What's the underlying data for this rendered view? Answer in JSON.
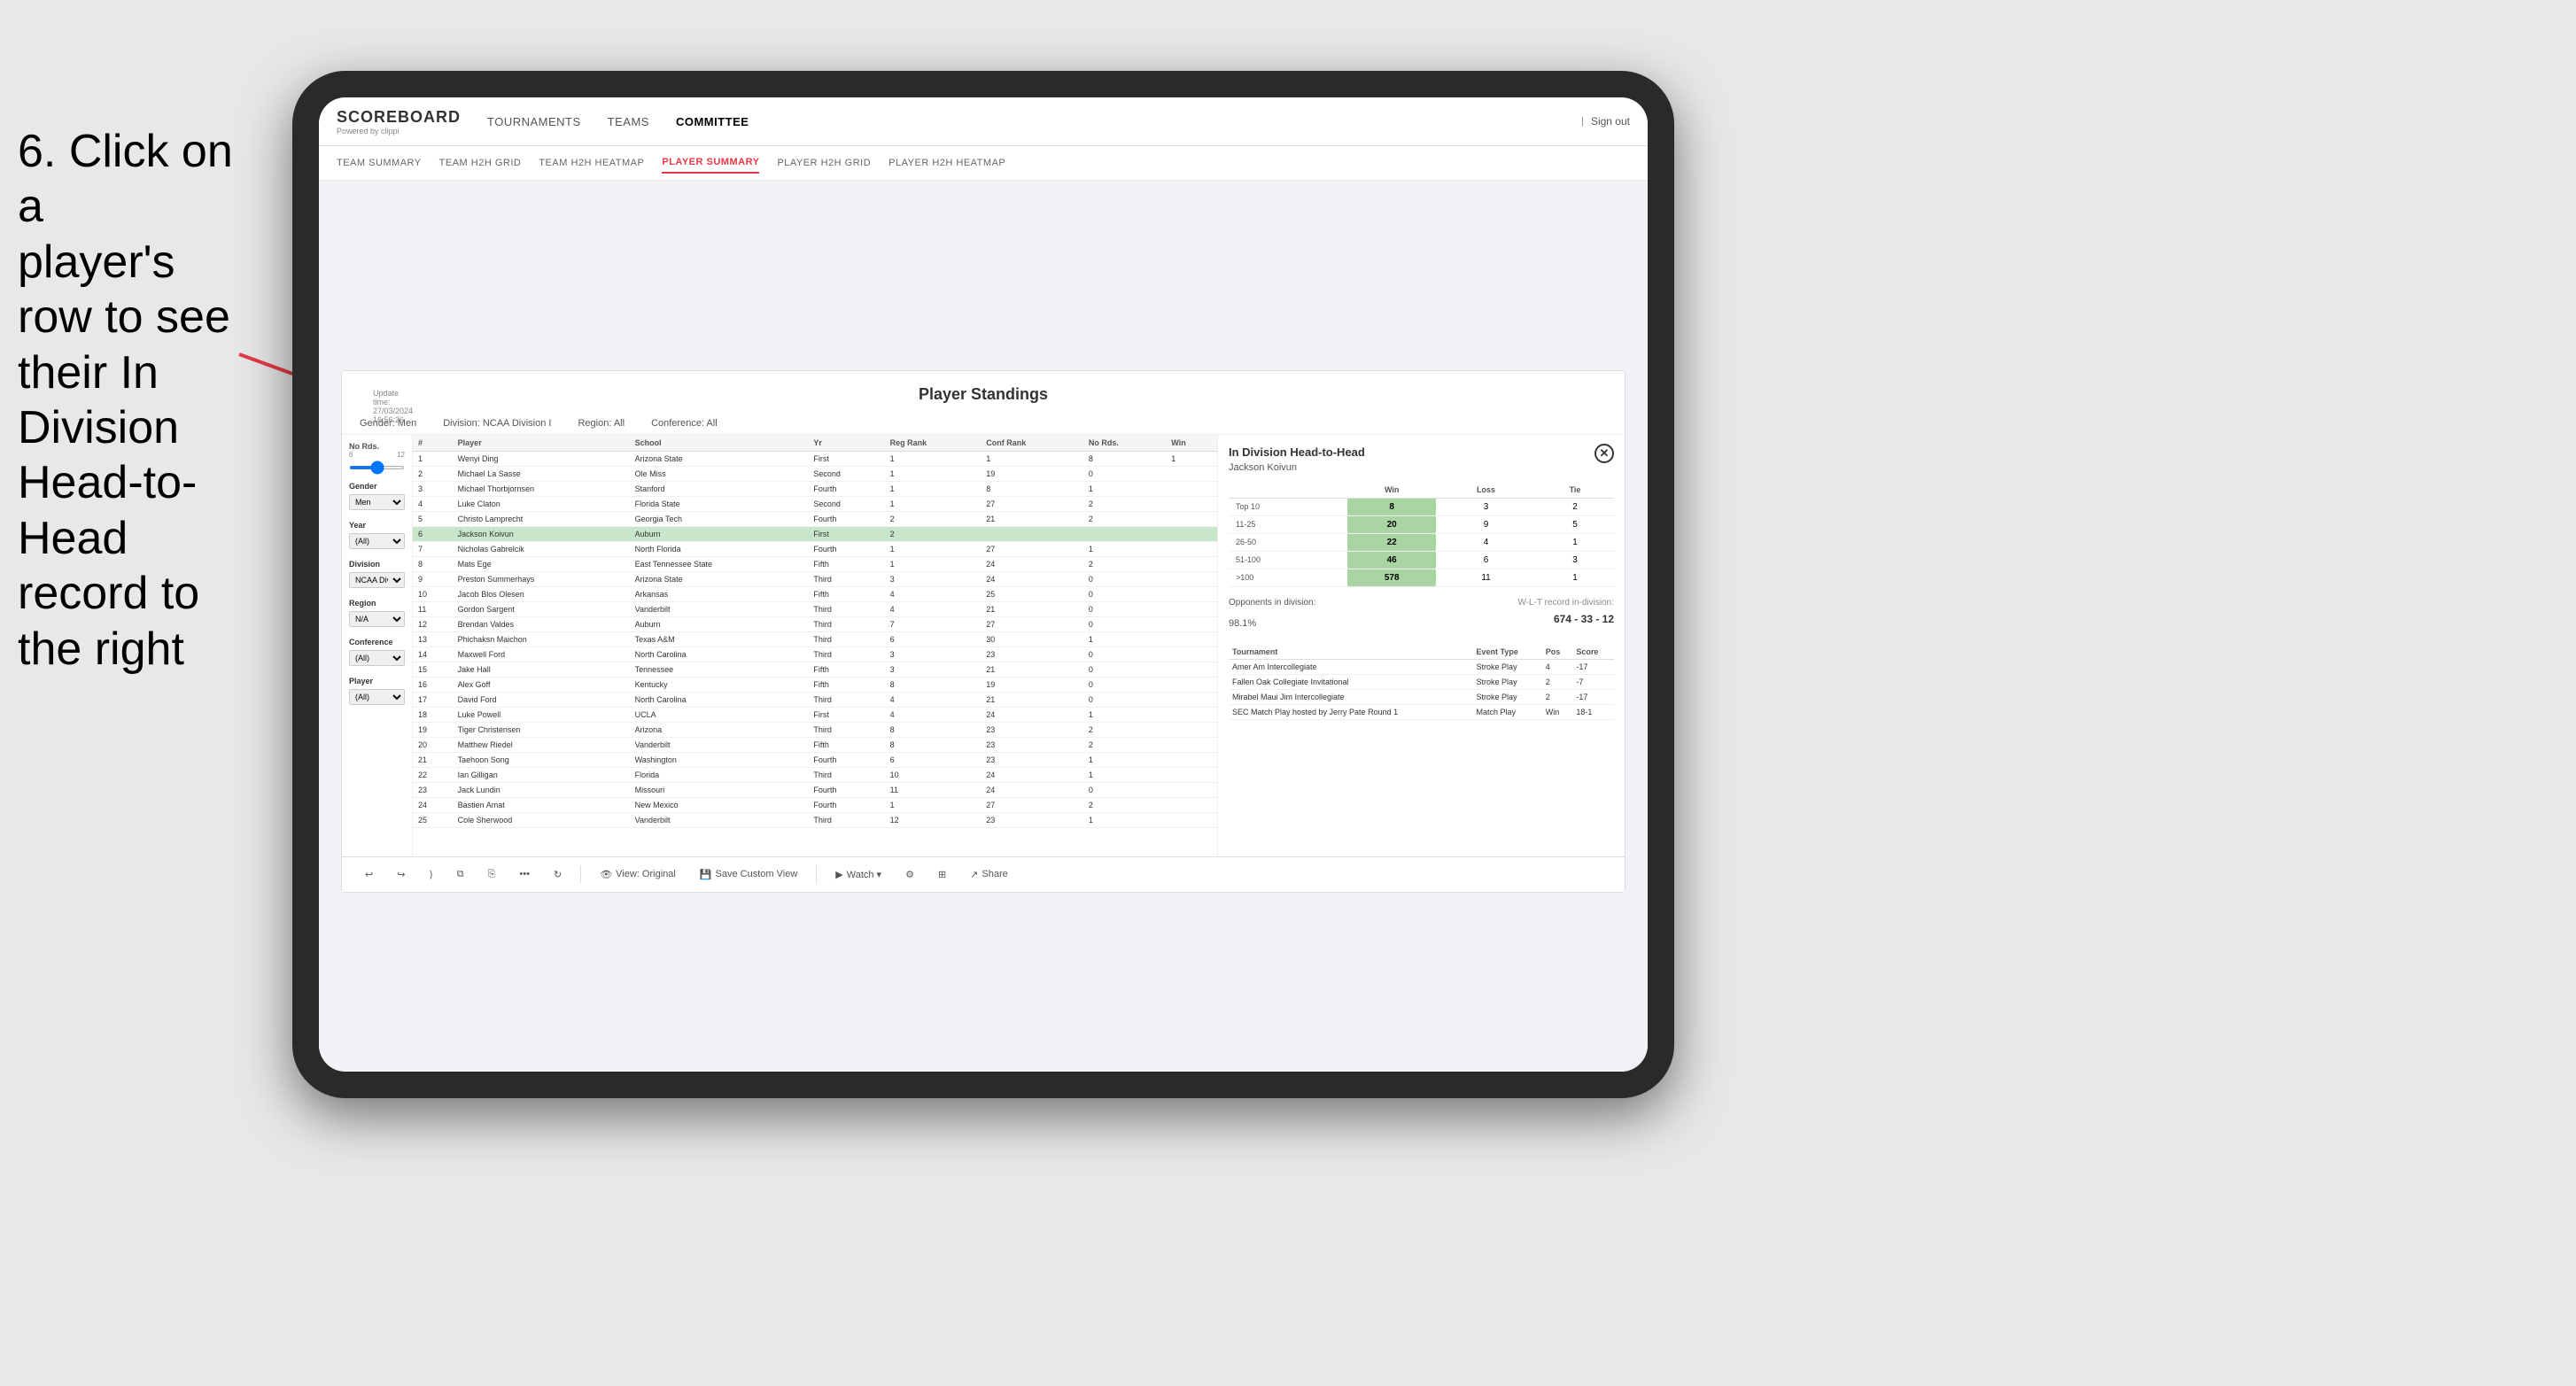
{
  "instruction": {
    "line1": "6. Click on a",
    "line2": "player's row to see",
    "line3": "their In Division",
    "line4": "Head-to-Head",
    "line5": "record to the right"
  },
  "nav": {
    "logo": "SCOREBOARD",
    "logo_sub": "Powered by clippi",
    "items": [
      "TOURNAMENTS",
      "TEAMS",
      "COMMITTEE"
    ],
    "sign_out": "Sign out"
  },
  "sub_nav": {
    "items": [
      "TEAM SUMMARY",
      "TEAM H2H GRID",
      "TEAM H2H HEATMAP",
      "PLAYER SUMMARY",
      "PLAYER H2H GRID",
      "PLAYER H2H HEATMAP"
    ]
  },
  "panel": {
    "title": "Player Standings",
    "update_time": "Update time:",
    "update_datetime": "27/03/2024 16:56:26",
    "filters": {
      "gender": "Gender: Men",
      "division": "Division: NCAA Division I",
      "region": "Region: All",
      "conference": "Conference: All"
    }
  },
  "sidebar": {
    "no_rds_label": "No Rds.",
    "no_rds_values": [
      "6",
      "12"
    ],
    "gender_label": "Gender",
    "gender_value": "Men",
    "year_label": "Year",
    "year_value": "(All)",
    "division_label": "Division",
    "division_value": "NCAA Division I",
    "region_label": "Region",
    "region_value": "N/A",
    "conference_label": "Conference",
    "conference_value": "(All)",
    "player_label": "Player",
    "player_value": "(All)"
  },
  "table": {
    "headers": [
      "#",
      "Player",
      "School",
      "Yr",
      "Reg Rank",
      "Conf Rank",
      "No Rds.",
      "Win"
    ],
    "rows": [
      {
        "num": 1,
        "player": "Wenyi Ding",
        "school": "Arizona State",
        "yr": "First",
        "reg": 1,
        "conf": 1,
        "rds": 8,
        "win": 1
      },
      {
        "num": 2,
        "player": "Michael La Sasse",
        "school": "Ole Miss",
        "yr": "Second",
        "reg": 1,
        "conf": 19,
        "rds": 0
      },
      {
        "num": 3,
        "player": "Michael Thorbjornsen",
        "school": "Stanford",
        "yr": "Fourth",
        "reg": 1,
        "conf": 8,
        "rds": 1
      },
      {
        "num": 4,
        "player": "Luke Claton",
        "school": "Florida State",
        "yr": "Second",
        "reg": 1,
        "conf": 27,
        "rds": 2
      },
      {
        "num": 5,
        "player": "Christo Lamprecht",
        "school": "Georgia Tech",
        "yr": "Fourth",
        "reg": 2,
        "conf": 21,
        "rds": 2
      },
      {
        "num": 6,
        "player": "Jackson Koivun",
        "school": "Auburn",
        "yr": "First",
        "reg": 2,
        "conf": "",
        "rds": "",
        "win": "",
        "highlighted": true
      },
      {
        "num": 7,
        "player": "Nicholas Gabrelcik",
        "school": "North Florida",
        "yr": "Fourth",
        "reg": 1,
        "conf": 27,
        "rds": 1
      },
      {
        "num": 8,
        "player": "Mats Ege",
        "school": "East Tennessee State",
        "yr": "Fifth",
        "reg": 1,
        "conf": 24,
        "rds": 2
      },
      {
        "num": 9,
        "player": "Preston Summerhays",
        "school": "Arizona State",
        "yr": "Third",
        "reg": 3,
        "conf": 24,
        "rds": 0
      },
      {
        "num": 10,
        "player": "Jacob Blos Olesen",
        "school": "Arkansas",
        "yr": "Fifth",
        "reg": 4,
        "conf": 25,
        "rds": 0
      },
      {
        "num": 11,
        "player": "Gordon Sargent",
        "school": "Vanderbilt",
        "yr": "Third",
        "reg": 4,
        "conf": 21,
        "rds": 0
      },
      {
        "num": 12,
        "player": "Brendan Valdes",
        "school": "Auburn",
        "yr": "Third",
        "reg": 7,
        "conf": 27,
        "rds": 0
      },
      {
        "num": 13,
        "player": "Phichaksn Maichon",
        "school": "Texas A&M",
        "yr": "Third",
        "reg": 6,
        "conf": 30,
        "rds": 1
      },
      {
        "num": 14,
        "player": "Maxwell Ford",
        "school": "North Carolina",
        "yr": "Third",
        "reg": 3,
        "conf": 23,
        "rds": 0
      },
      {
        "num": 15,
        "player": "Jake Hall",
        "school": "Tennessee",
        "yr": "Fifth",
        "reg": 3,
        "conf": 21,
        "rds": 0
      },
      {
        "num": 16,
        "player": "Alex Goff",
        "school": "Kentucky",
        "yr": "Fifth",
        "reg": 8,
        "conf": 19,
        "rds": 0
      },
      {
        "num": 17,
        "player": "David Ford",
        "school": "North Carolina",
        "yr": "Third",
        "reg": 4,
        "conf": 21,
        "rds": 0
      },
      {
        "num": 18,
        "player": "Luke Powell",
        "school": "UCLA",
        "yr": "First",
        "reg": 4,
        "conf": 24,
        "rds": 1
      },
      {
        "num": 19,
        "player": "Tiger Christensen",
        "school": "Arizona",
        "yr": "Third",
        "reg": 8,
        "conf": 23,
        "rds": 2
      },
      {
        "num": 20,
        "player": "Matthew Riedel",
        "school": "Vanderbilt",
        "yr": "Fifth",
        "reg": 8,
        "conf": 23,
        "rds": 2
      },
      {
        "num": 21,
        "player": "Taehoon Song",
        "school": "Washington",
        "yr": "Fourth",
        "reg": 6,
        "conf": 23,
        "rds": 1
      },
      {
        "num": 22,
        "player": "Ian Gilligan",
        "school": "Florida",
        "yr": "Third",
        "reg": 10,
        "conf": 24,
        "rds": 1
      },
      {
        "num": 23,
        "player": "Jack Lundin",
        "school": "Missouri",
        "yr": "Fourth",
        "reg": 11,
        "conf": 24,
        "rds": 0
      },
      {
        "num": 24,
        "player": "Bastien Amat",
        "school": "New Mexico",
        "yr": "Fourth",
        "reg": 1,
        "conf": 27,
        "rds": 2
      },
      {
        "num": 25,
        "player": "Cole Sherwood",
        "school": "Vanderbilt",
        "yr": "Third",
        "reg": 12,
        "conf": 23,
        "rds": 1
      }
    ]
  },
  "h2h": {
    "title": "In Division Head-to-Head",
    "player_name": "Jackson Koivun",
    "table": {
      "headers": [
        "",
        "Win",
        "Loss",
        "Tie"
      ],
      "rows": [
        {
          "label": "Top 10",
          "win": 8,
          "loss": 3,
          "tie": 2
        },
        {
          "label": "11-25",
          "win": 20,
          "loss": 9,
          "tie": 5
        },
        {
          "label": "26-50",
          "win": 22,
          "loss": 4,
          "tie": 1
        },
        {
          "label": "51-100",
          "win": 46,
          "loss": 6,
          "tie": 3
        },
        {
          "label": ">100",
          "win": 578,
          "loss": 11,
          "tie": 1
        }
      ]
    },
    "opponents_label": "Opponents in division:",
    "opponents_pct": "98.1%",
    "wl_label": "W-L-T record in-division:",
    "wl_record": "674 - 33 - 12",
    "tournaments_headers": [
      "Tournament",
      "Event Type",
      "Pos",
      "Score"
    ],
    "tournaments": [
      {
        "name": "Amer Am Intercollegiate",
        "type": "Stroke Play",
        "pos": 4,
        "score": "-17"
      },
      {
        "name": "Fallen Oak Collegiate Invitational",
        "type": "Stroke Play",
        "pos": 2,
        "score": "-7"
      },
      {
        "name": "Mirabel Maui Jim Intercollegiate",
        "type": "Stroke Play",
        "pos": 2,
        "score": "-17"
      },
      {
        "name": "SEC Match Play hosted by Jerry Pate Round 1",
        "type": "Match Play",
        "pos": "Win",
        "score": "18-1"
      }
    ]
  },
  "toolbar": {
    "undo": "↩",
    "redo": "↪",
    "forward": "⟩",
    "view_original": "View: Original",
    "save_custom": "Save Custom View",
    "watch": "Watch ▾",
    "share": "Share"
  }
}
